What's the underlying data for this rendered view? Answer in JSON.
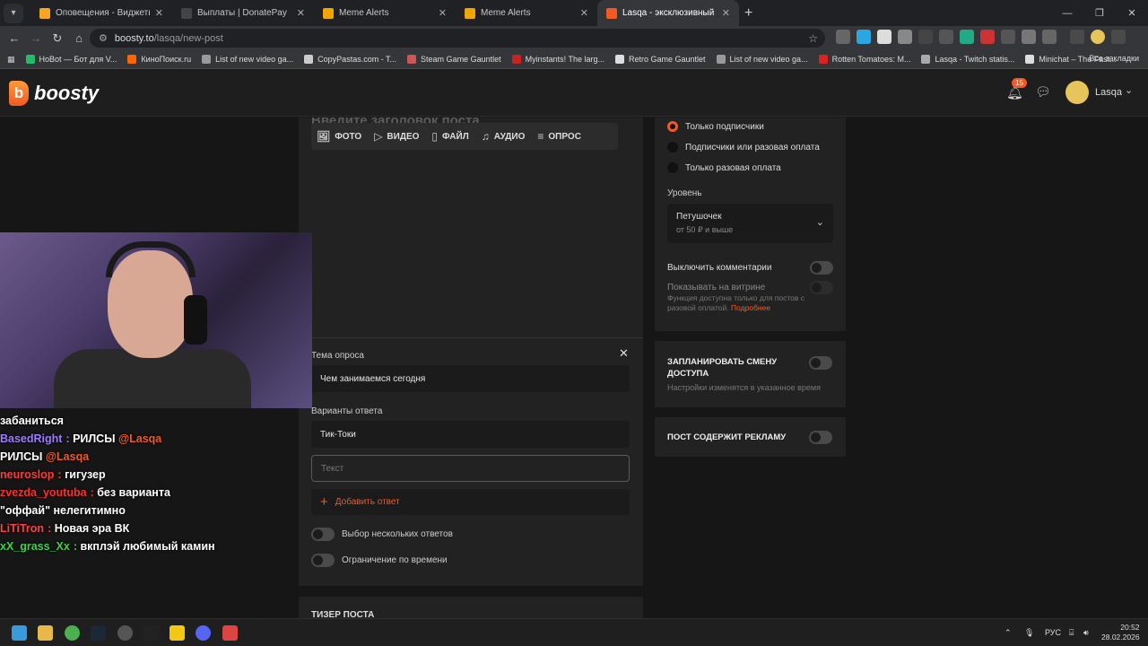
{
  "browser": {
    "tabs": [
      {
        "label": "Оповещения - Виджеты - Don",
        "color": "#f5a623"
      },
      {
        "label": "Выплаты | DonatePay",
        "color": "#1d1d1d"
      },
      {
        "label": "Meme Alerts",
        "color": "#f0a500"
      },
      {
        "label": "Meme Alerts",
        "color": "#f0a500"
      },
      {
        "label": "Lasqa - эксклюзивный контен",
        "color": "#f15a24"
      }
    ],
    "url_host": "boosty.to",
    "url_path": "/lasqa/new-post",
    "bookmarks": [
      "HoBot — Бот для V...",
      "КиноПоиск.ru",
      "List of new video ga...",
      "CopyPastas.com - T...",
      "Steam Game Gauntlet",
      "Myinstants! The larg...",
      "Retro Game Gauntlet",
      "List of new video ga...",
      "Rotten Tomatoes: M...",
      "Lasqa - Twitch statis...",
      "Minichat – The Fast..."
    ],
    "bookmarks_all": "Все закладки"
  },
  "header": {
    "logo": "boosty",
    "notif_count": "15",
    "user": "Lasqa"
  },
  "editor": {
    "title_placeholder": "Введите заголовок поста",
    "tools": [
      {
        "label": "ФОТО",
        "icon": "photo-icon"
      },
      {
        "label": "ВИДЕО",
        "icon": "video-icon"
      },
      {
        "label": "ФАЙЛ",
        "icon": "file-icon"
      },
      {
        "label": "АУДИО",
        "icon": "audio-icon"
      },
      {
        "label": "ОПРОС",
        "icon": "poll-icon"
      }
    ],
    "poll": {
      "topic_label": "Тема опроса",
      "topic_value": "Чем занимаемся сегодня",
      "answers_label": "Варианты ответа",
      "answer1": "Тик-Токи",
      "answer_placeholder": "Текст",
      "add_answer": "Добавить ответ",
      "multi": "Выбор нескольких ответов",
      "time_limit": "Ограничение по времени"
    },
    "teaser": "ТИЗЕР ПОСТА"
  },
  "access": {
    "options": [
      "Только подписчики",
      "Подписчики или разовая оплата",
      "Только разовая оплата"
    ],
    "selected": 0,
    "level_label": "Уровень",
    "level_name": "Петушочек",
    "level_price": "от 50 ₽ и выше",
    "disable_comments": "Выключить комментарии",
    "showcase": "Показывать на витрине",
    "note": "Функция доступна только для постов с разовой оплатой.",
    "note_link": "Подробнее"
  },
  "schedule": {
    "title": "ЗАПЛАНИРОВАТЬ СМЕНУ ДОСТУПА",
    "sub": "Настройки изменятся в указанное время"
  },
  "ads": {
    "title": "ПОСТ СОДЕРЖИТ РЕКЛАМУ"
  },
  "chat": [
    {
      "user": "",
      "msg": "забаниться",
      "color": "#ffffff"
    },
    {
      "user": "BasedRight",
      "msg": "РИЛСЫ",
      "mention": "@Lasqa",
      "color": "#9b7bff"
    },
    {
      "user": "",
      "msg": "РИЛСЫ",
      "mention": "@Lasqa",
      "color": "#ffffff"
    },
    {
      "user": "neuroslop",
      "msg": "гигузер",
      "color": "#ff3b3b"
    },
    {
      "user": "zvezda_youtuba",
      "msg": "без варианта",
      "color": "#ff2e2e"
    },
    {
      "user": "",
      "msg": "\"оффай\" нелегитимно",
      "color": "#ffffff"
    },
    {
      "user": "LiTiTron",
      "msg": "Новая эра ВК",
      "color": "#ff4040"
    },
    {
      "user": "xX_grass_Xx",
      "msg": "вкплэй любимый камин",
      "color": "#3fd14f"
    }
  ],
  "taskbar": {
    "lang": "РУС",
    "time": "20:52",
    "date": "28.02.2026"
  }
}
